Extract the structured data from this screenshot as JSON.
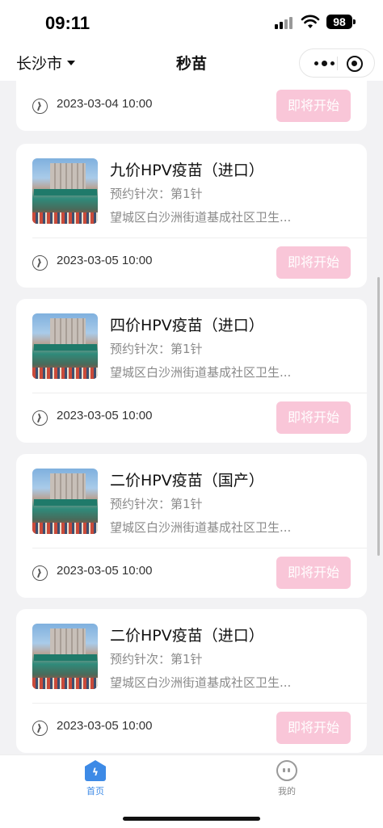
{
  "status_bar": {
    "time": "09:11",
    "battery": "98"
  },
  "nav": {
    "city": "长沙市",
    "title": "秒苗"
  },
  "cards": [
    {
      "name": "",
      "dose": "",
      "address": "",
      "start_time": "2023-03-04 10:00",
      "status": "即将开始"
    },
    {
      "name": "九价HPV疫苗（进口）",
      "dose": "预约针次：第1针",
      "address": "望城区白沙洲街道基成社区卫生...",
      "start_time": "2023-03-05 10:00",
      "status": "即将开始"
    },
    {
      "name": "四价HPV疫苗（进口）",
      "dose": "预约针次：第1针",
      "address": "望城区白沙洲街道基成社区卫生...",
      "start_time": "2023-03-05 10:00",
      "status": "即将开始"
    },
    {
      "name": "二价HPV疫苗（国产）",
      "dose": "预约针次：第1针",
      "address": "望城区白沙洲街道基成社区卫生...",
      "start_time": "2023-03-05 10:00",
      "status": "即将开始"
    },
    {
      "name": "二价HPV疫苗（进口）",
      "dose": "预约针次：第1针",
      "address": "望城区白沙洲街道基成社区卫生...",
      "start_time": "2023-03-05 10:00",
      "status": "即将开始"
    }
  ],
  "tab_bar": {
    "items": [
      {
        "label": "首页",
        "icon": "home-bolt-icon",
        "active": true,
        "color": "#3d8ae6"
      },
      {
        "label": "我的",
        "icon": "smiley-face-icon",
        "active": false,
        "color": "#888888"
      }
    ]
  },
  "colors": {
    "button_disabled_bg": "#f9c6d8",
    "page_bg": "#f2f2f4",
    "accent": "#3d8ae6"
  }
}
